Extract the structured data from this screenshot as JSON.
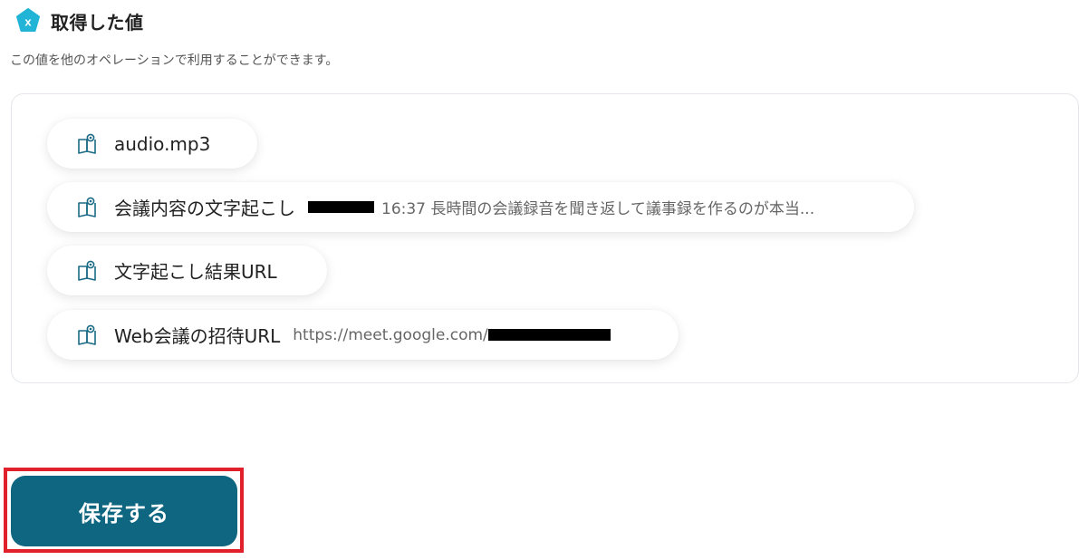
{
  "header": {
    "title": "取得した値",
    "badge_letter": "x",
    "badge_color": "#22b4d6"
  },
  "description": "この値を他のオペレーションで利用することができます。",
  "values": [
    {
      "label": "audio.mp3",
      "preview": ""
    },
    {
      "label": "会議内容の文字起こし",
      "preview": "16:37 長時間の会議録音を聞き返して議事録を作るのが本当..."
    },
    {
      "label": "文字起こし結果URL",
      "preview": ""
    },
    {
      "label": "Web会議の招待URL",
      "preview": "https://meet.google.com/"
    }
  ],
  "value_icon": "book-icon",
  "save_button": {
    "label": "保存する",
    "color": "#0f6680"
  },
  "highlight_color": "#e0202a"
}
